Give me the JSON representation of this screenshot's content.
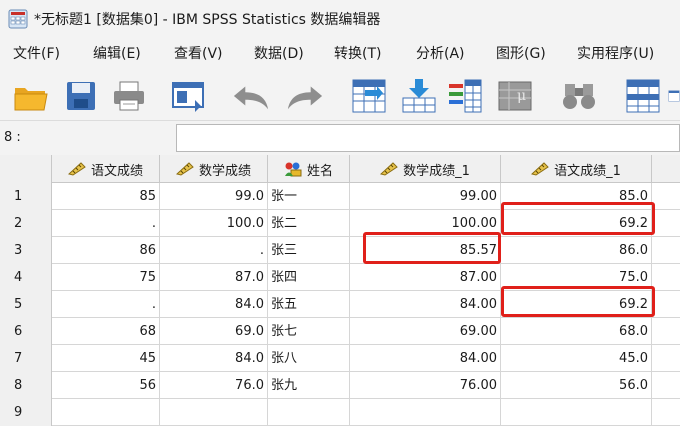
{
  "window": {
    "title": "*无标题1 [数据集0] - IBM SPSS Statistics 数据编辑器"
  },
  "menu": {
    "items": [
      "文件(F)",
      "编辑(E)",
      "查看(V)",
      "数据(D)",
      "转换(T)",
      "分析(A)",
      "图形(G)",
      "实用程序(U)"
    ]
  },
  "toolbar": {
    "icons": [
      "open-folder-icon",
      "save-icon",
      "print-icon",
      "dialog-recall-icon",
      "undo-icon",
      "redo-icon",
      "goto-case-icon",
      "goto-variable-icon",
      "variables-icon",
      "run-descriptive-icon",
      "find-icon",
      "insert-cases-icon",
      "insert-variable-icon"
    ]
  },
  "cell_editor": {
    "reference": "8 :",
    "value": ""
  },
  "grid": {
    "columns": [
      {
        "name": "语文成绩",
        "type": "scale"
      },
      {
        "name": "数学成绩",
        "type": "scale"
      },
      {
        "name": "姓名",
        "type": "nominal"
      },
      {
        "name": "数学成绩_1",
        "type": "scale"
      },
      {
        "name": "语文成绩_1",
        "type": "scale"
      }
    ],
    "rows": [
      {
        "n": "1",
        "c1": "85",
        "c2": "99.0",
        "c3": "张一",
        "c4": "99.00",
        "c5": "85.0"
      },
      {
        "n": "2",
        "c1": ".",
        "c2": "100.0",
        "c3": "张二",
        "c4": "100.00",
        "c5": "69.2"
      },
      {
        "n": "3",
        "c1": "86",
        "c2": ".",
        "c3": "张三",
        "c4": "85.57",
        "c5": "86.0"
      },
      {
        "n": "4",
        "c1": "75",
        "c2": "87.0",
        "c3": "张四",
        "c4": "87.00",
        "c5": "75.0"
      },
      {
        "n": "5",
        "c1": ".",
        "c2": "84.0",
        "c3": "张五",
        "c4": "84.00",
        "c5": "69.2"
      },
      {
        "n": "6",
        "c1": "68",
        "c2": "69.0",
        "c3": "张七",
        "c4": "69.00",
        "c5": "68.0"
      },
      {
        "n": "7",
        "c1": "45",
        "c2": "84.0",
        "c3": "张八",
        "c4": "84.00",
        "c5": "45.0"
      },
      {
        "n": "8",
        "c1": "56",
        "c2": "76.0",
        "c3": "张九",
        "c4": "76.00",
        "c5": "56.0"
      },
      {
        "n": "9",
        "c1": "",
        "c2": "",
        "c3": "",
        "c4": "",
        "c5": ""
      }
    ]
  },
  "highlight_color": "#e0201a"
}
